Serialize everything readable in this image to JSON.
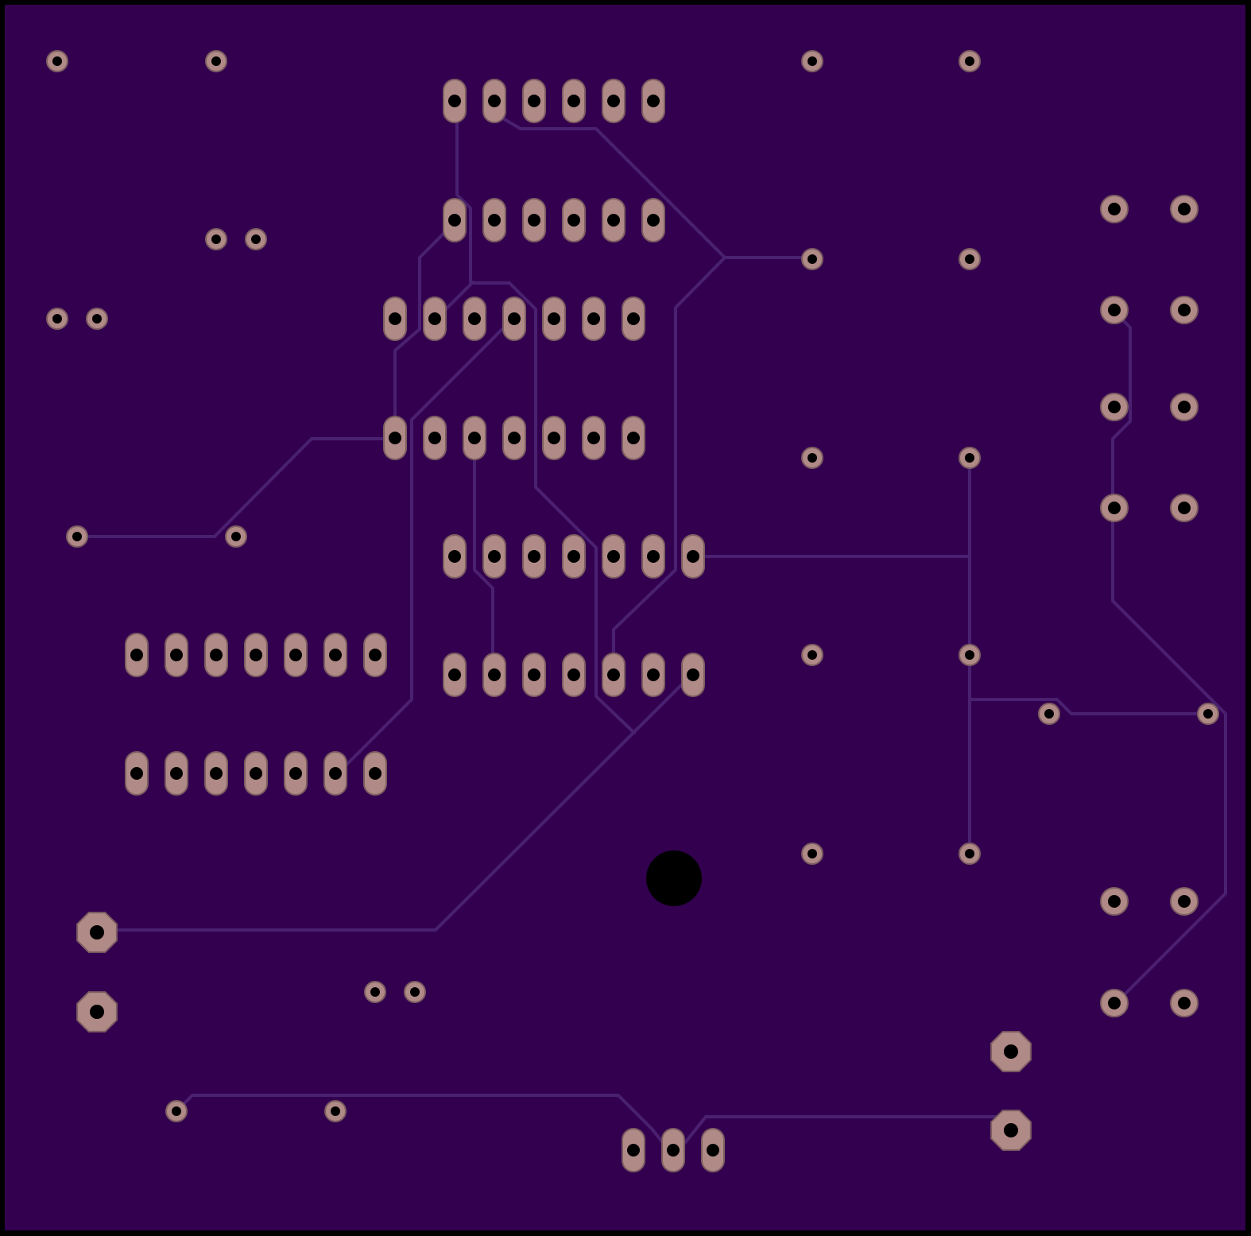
{
  "board": {
    "title": "",
    "colors": {
      "substrate": "#33004f",
      "outline": "#000000",
      "trace": "#4a2170",
      "pad": "#b08a86",
      "pad_edge": "#7d5e62",
      "drill": "#000000"
    }
  }
}
